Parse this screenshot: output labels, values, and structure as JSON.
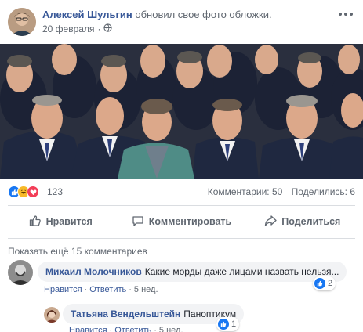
{
  "post": {
    "author": "Алексей Шульгин",
    "action": "обновил свое фото обложки.",
    "date": "20 февраля",
    "privacy_icon": "globe-icon",
    "menu_icon": "more-dots-icon"
  },
  "cover": {
    "description_icon": "photo-of-people-seated",
    "colors": {
      "background": "#2a2f3e",
      "suit": "#1f2840",
      "skin": "#d9a98c",
      "teal_jacket": "#4f8c86"
    }
  },
  "stats": {
    "reactions": [
      "like",
      "haha",
      "love"
    ],
    "reaction_count": "123",
    "comments": "Комментарии: 50",
    "shares": "Поделились: 6"
  },
  "actions": {
    "like": "Нравится",
    "comment": "Комментировать",
    "share": "Поделиться"
  },
  "comments": {
    "show_more": "Показать ещё 15 комментариев",
    "items": [
      {
        "name": "Михаил Молочников",
        "text": "Какие морды даже лицами назвать нельзя...",
        "like": "Нравится",
        "reply": "Ответить",
        "time": "5 нед.",
        "reactions": "2"
      },
      {
        "name": "Татьяна Вендельштейн",
        "text": "Паноптикум",
        "like": "Нравится",
        "reply": "Ответить",
        "time": "5 нед.",
        "reactions": "1"
      }
    ]
  },
  "colors": {
    "link": "#385898",
    "secondary": "#606770",
    "like_blue": "#1877f2",
    "bubble": "#f2f3f5"
  }
}
